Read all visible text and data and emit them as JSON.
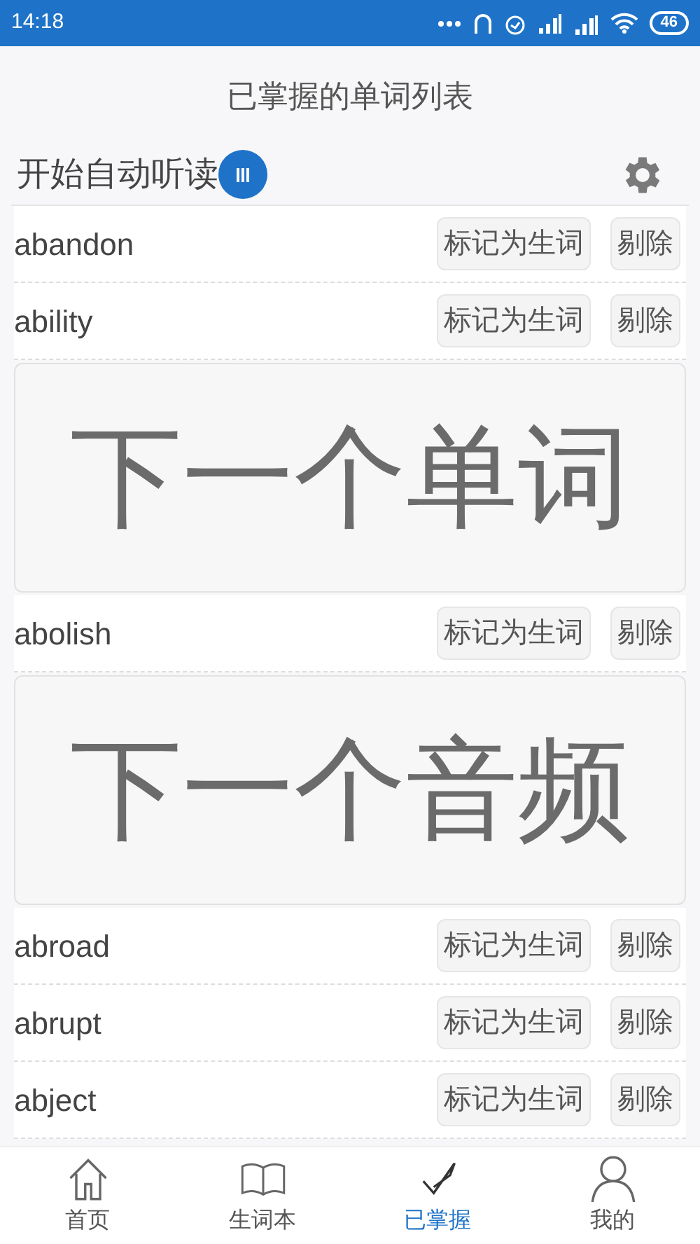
{
  "status_bar": {
    "time": "14:18",
    "battery": "46"
  },
  "title": "已掌握的单词列表",
  "auto_read": {
    "label": "开始自动听读",
    "playing": true
  },
  "list": [
    {
      "kind": "word",
      "word": "abandon",
      "mark_button": "标记为生词",
      "delete_button": "剔除"
    },
    {
      "kind": "word",
      "word": "ability",
      "mark_button": "标记为生词",
      "delete_button": "剔除"
    },
    {
      "kind": "panel",
      "label": "下一个单词"
    },
    {
      "kind": "word",
      "word": "abolish",
      "mark_button": "标记为生词",
      "delete_button": "剔除"
    },
    {
      "kind": "panel",
      "label": "下一个音频"
    },
    {
      "kind": "word",
      "word": "abroad",
      "mark_button": "标记为生词",
      "delete_button": "剔除"
    },
    {
      "kind": "word",
      "word": "abrupt",
      "mark_button": "标记为生词",
      "delete_button": "剔除"
    },
    {
      "kind": "word",
      "word": "abject",
      "mark_button": "标记为生词",
      "delete_button": "剔除"
    }
  ],
  "tabs": [
    {
      "label": "首页",
      "kind": "home",
      "selected": false
    },
    {
      "label": "生词本",
      "kind": "book",
      "selected": false
    },
    {
      "label": "已掌握",
      "kind": "check",
      "selected": true
    },
    {
      "label": "我的",
      "kind": "person",
      "selected": false
    }
  ]
}
